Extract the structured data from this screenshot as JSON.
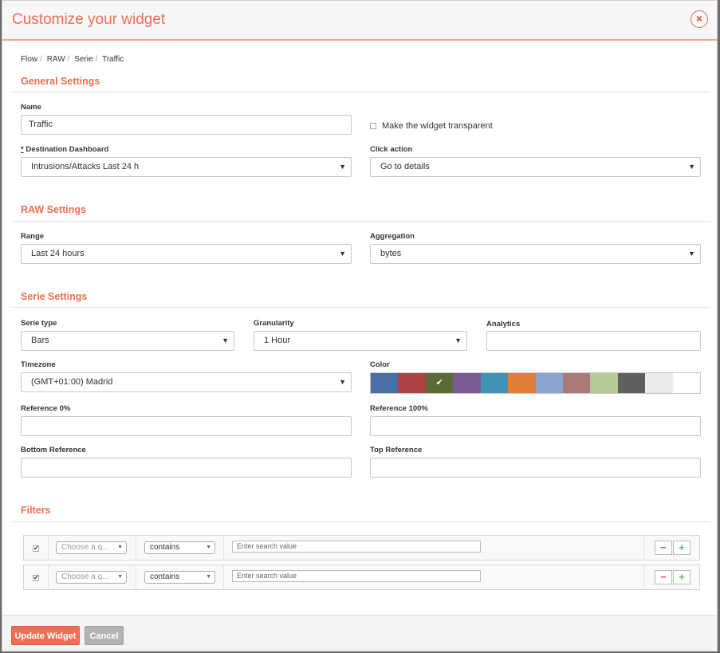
{
  "modal": {
    "title": "Customize your widget",
    "close_glyph": "×"
  },
  "breadcrumb": [
    "Flow",
    "RAW",
    "Serie",
    "Traffic"
  ],
  "general": {
    "heading": "General Settings",
    "name_label": "Name",
    "name_value": "Traffic",
    "transparent_label": "Make the widget transparent",
    "dest_label_marker": "*",
    "dest_label": "Destination Dashboard",
    "dest_value": "Intrusions/Attacks Last 24 h",
    "click_label": "Click action",
    "click_value": "Go to details"
  },
  "raw": {
    "heading": "RAW Settings",
    "range_label": "Range",
    "range_value": "Last 24 hours",
    "agg_label": "Aggregation",
    "agg_value": "bytes"
  },
  "serie": {
    "heading": "Serie Settings",
    "type_label": "Serie type",
    "type_value": "Bars",
    "gran_label": "Granularity",
    "gran_value": "1 Hour",
    "analytics_label": "Analytics",
    "tz_label": "Timezone",
    "tz_value": "(GMT+01:00) Madrid",
    "color_label": "Color",
    "colors": [
      "#4a6fa5",
      "#a94442",
      "#5a6b35",
      "#7a5c92",
      "#3d93b3",
      "#e07d39",
      "#8aa4cc",
      "#a97a77",
      "#b4c994",
      "#5f5f5f",
      "#ebebeb",
      "#ffffff"
    ],
    "selected_color_index": 2,
    "ref0_label": "Reference 0%",
    "ref100_label": "Reference 100%",
    "bottom_label": "Bottom Reference",
    "top_label": "Top Reference"
  },
  "filters": {
    "heading": "Filters",
    "rows": [
      {
        "field_placeholder": "Choose a q...",
        "operator": "contains",
        "value_placeholder": "Enter search value"
      },
      {
        "field_placeholder": "Choose a q...",
        "operator": "contains",
        "value_placeholder": "Enter search value"
      }
    ],
    "minus": "−",
    "plus": "+"
  },
  "footer": {
    "update_label": "Update Widget",
    "cancel_label": "Cancel"
  },
  "colors": {
    "accent": "#ef6e55",
    "update_btn": "#ef6e55",
    "cancel_btn": "#b3b3b3"
  }
}
